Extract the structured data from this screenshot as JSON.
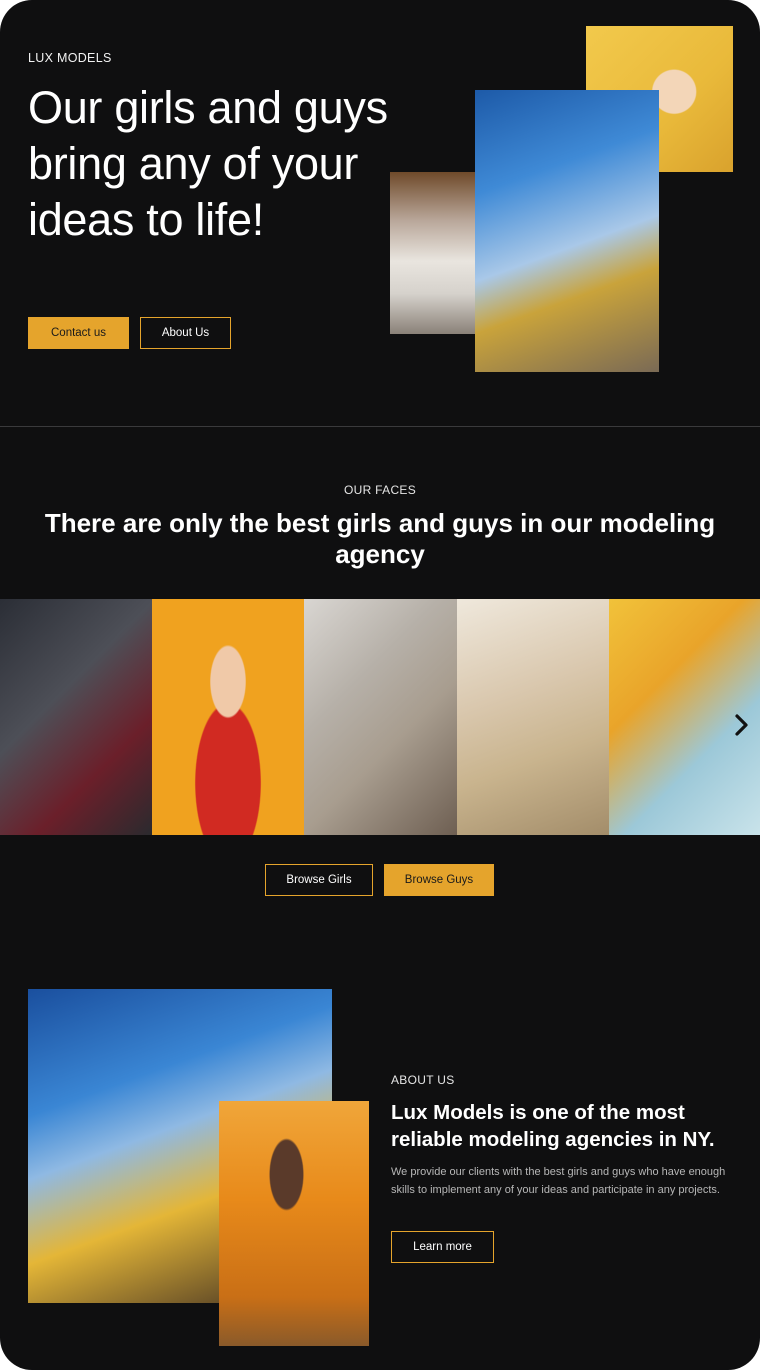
{
  "hero": {
    "brand": "LUX MODELS",
    "title": "Our girls and guys bring any of your ideas to life!",
    "contact_button": "Contact us",
    "about_button": "About Us"
  },
  "faces": {
    "eyebrow": "OUR FACES",
    "title": "There are only the best girls and guys in our modeling agency",
    "next_icon": "chevron-right-icon",
    "browse_girls_button": "Browse Girls",
    "browse_guys_button": "Browse Guys"
  },
  "about": {
    "eyebrow": "ABOUT US",
    "title": "Lux Models is one of the most reliable modeling agencies in NY.",
    "text": "We provide our clients with the best girls and guys who have enough skills to implement any of your ideas and participate in any projects.",
    "learn_more_button": "Learn more"
  },
  "colors": {
    "background": "#0f0f10",
    "accent": "#e5a42c",
    "text": "#ffffff",
    "muted_text": "#b7b7b7"
  }
}
